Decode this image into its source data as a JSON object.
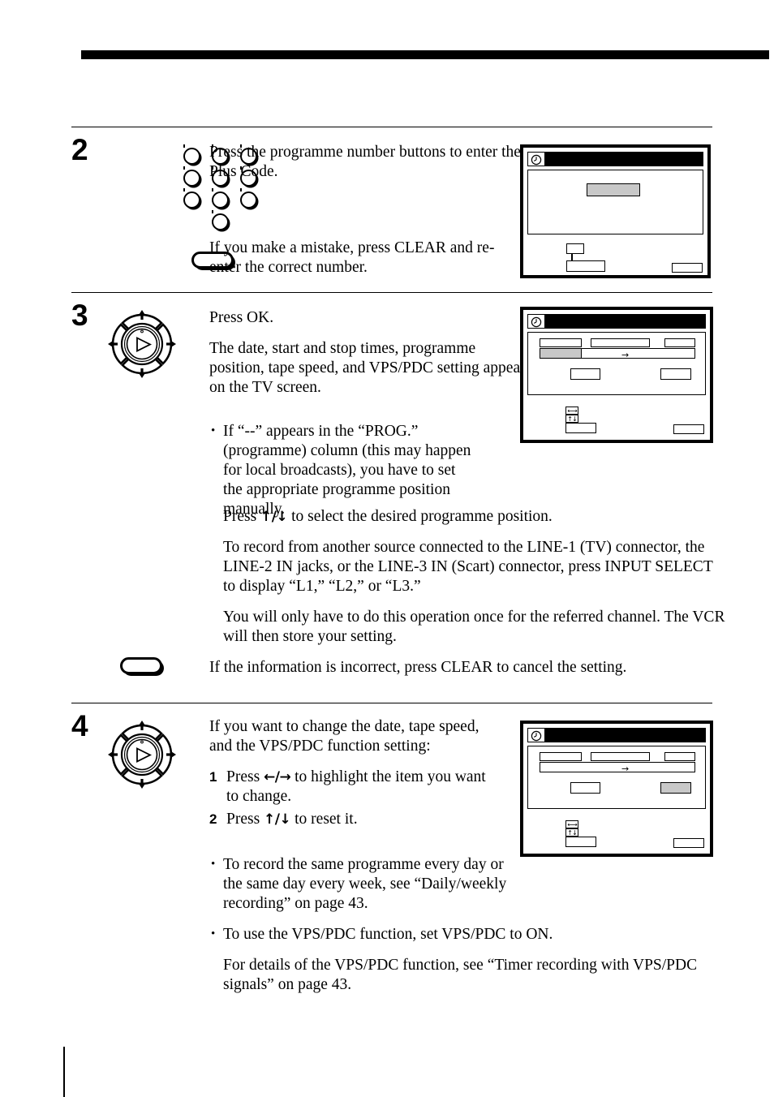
{
  "page": {
    "document_type": "vcr-instruction-manual",
    "header_rule": true
  },
  "steps": [
    {
      "number": "2",
      "art": "number-keypad-and-clear-button",
      "paragraphs": [
        "Press the programme number buttons to enter the Plus Code.",
        "If you make a mistake, press CLEAR and re-enter the correct number."
      ]
    },
    {
      "number": "3",
      "art": "jog-dial-and-clear-button",
      "paragraphs": [
        "Press OK.",
        "The date, start and stop times, programme position, tape speed, and VPS/PDC setting appear on the TV screen."
      ],
      "bullet_1": "If “--” appears in the “PROG.” (programme) column (this may happen for local broadcasts), you have to set the appropriate programme position manually.",
      "press_updown_prefix": "Press ",
      "press_updown_suffix": " to select the desired programme position.",
      "updown_glyph": "↑/↓",
      "paragraph_line_source": "To record from another source connected to the LINE-1 (TV) connector, the LINE-2 IN jacks, or the LINE-3 IN (Scart) connector, press INPUT SELECT to display “L1,” “L2,” or “L3.”",
      "paragraph_referred": "You will only have to do this operation once for the referred channel.  The VCR will then store your setting.",
      "paragraph_clear": "If the information is incorrect, press CLEAR to cancel the setting."
    },
    {
      "number": "4",
      "art": "jog-dial",
      "intro": "If you want to change the date, tape speed, and the VPS/PDC function setting:",
      "numbered": [
        {
          "label": "1",
          "prefix": "Press ",
          "glyph": "←/→",
          "suffix": " to highlight the item you want to change."
        },
        {
          "label": "2",
          "prefix": "Press ",
          "glyph": "↑/↓",
          "suffix": " to reset it."
        }
      ],
      "bullets": [
        "To record the same programme every day or the same day every week, see “Daily/weekly recording” on page 43.",
        "To use the VPS/PDC function, set VPS/PDC to ON."
      ],
      "closing": "For details of the VPS/PDC function, see “Timer recording with VPS/PDC signals” on page 43."
    }
  ],
  "osd_screens": [
    {
      "id": "osd-plus-code-entry",
      "clock_icon": "clock-icon",
      "titlebar": "black",
      "fields": [
        {
          "name": "plus-code-entry-field",
          "highlighted": true
        }
      ],
      "guides": [
        {
          "name": "guide-box-upper",
          "glyph": ""
        },
        {
          "name": "guide-box-lower",
          "glyph": ""
        }
      ],
      "footer_button": {
        "name": "osd-footer-button",
        "label": ""
      }
    },
    {
      "id": "osd-timer-confirm",
      "clock_icon": "clock-icon",
      "titlebar": "black",
      "columns": [
        {
          "name": "osd-column-date",
          "highlighted": false
        },
        {
          "name": "osd-column-times",
          "highlighted": false
        },
        {
          "name": "osd-column-prog",
          "highlighted": false
        }
      ],
      "row": {
        "name": "osd-entry-row",
        "highlighted_left": true,
        "arrow_glyph": "→"
      },
      "fields": [
        {
          "name": "osd-field-tape-speed",
          "highlighted": false
        },
        {
          "name": "osd-field-vps-pdc",
          "highlighted": false
        }
      ],
      "guides": [
        {
          "name": "guide-leftright-arrows",
          "glyph": "←→"
        },
        {
          "name": "guide-updown-arrows",
          "glyph": "↑↓"
        },
        {
          "name": "guide-box-lower",
          "glyph": ""
        }
      ],
      "footer_button": {
        "name": "osd-footer-button",
        "label": ""
      }
    },
    {
      "id": "osd-timer-edit",
      "clock_icon": "clock-icon",
      "titlebar": "black",
      "columns": [
        {
          "name": "osd-column-date",
          "highlighted": false
        },
        {
          "name": "osd-column-times",
          "highlighted": false
        },
        {
          "name": "osd-column-prog",
          "highlighted": false
        }
      ],
      "row": {
        "name": "osd-entry-row",
        "highlighted_left": false,
        "arrow_glyph": "→"
      },
      "fields": [
        {
          "name": "osd-field-tape-speed",
          "highlighted": false
        },
        {
          "name": "osd-field-vps-pdc",
          "highlighted": true
        }
      ],
      "guides": [
        {
          "name": "guide-leftright-arrows",
          "glyph": "←→"
        },
        {
          "name": "guide-updown-arrows",
          "glyph": "↑↓"
        },
        {
          "name": "guide-box-lower",
          "glyph": ""
        }
      ],
      "footer_button": {
        "name": "osd-footer-button",
        "label": ""
      }
    }
  ],
  "colors": {
    "ink": "#000000",
    "paper": "#ffffff",
    "highlight": "#c8c8c8"
  }
}
